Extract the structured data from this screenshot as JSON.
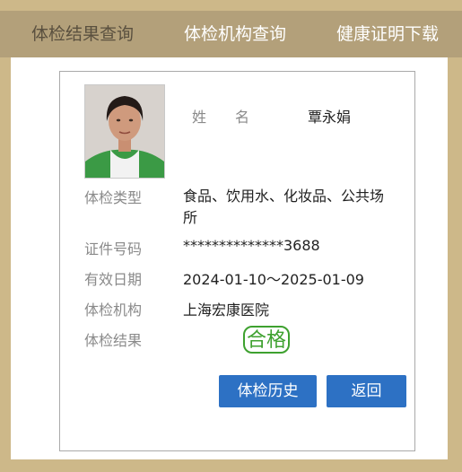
{
  "nav": {
    "tabs": [
      {
        "label": "体检结果查询"
      },
      {
        "label": "体检机构查询"
      },
      {
        "label": "健康证明下载"
      }
    ]
  },
  "card": {
    "name_label": "姓　　名",
    "name_value": "覃永娟",
    "type_label": "体检类型",
    "type_value": "食品、饮用水、化妆品、公共场所",
    "id_label": "证件号码",
    "id_value": "**************3688",
    "valid_label": "有效日期",
    "valid_value": "2024-01-10～2025-01-09",
    "org_label": "体检机构",
    "org_value": "上海宏康医院",
    "result_label": "体检结果",
    "result_stamp": "合格"
  },
  "buttons": {
    "history": "体检历史",
    "back": "返回"
  },
  "colors": {
    "frame": "#cdb889",
    "nav_bg": "#b3a07a",
    "button": "#2d71c4",
    "stamp": "#3ea12f"
  }
}
